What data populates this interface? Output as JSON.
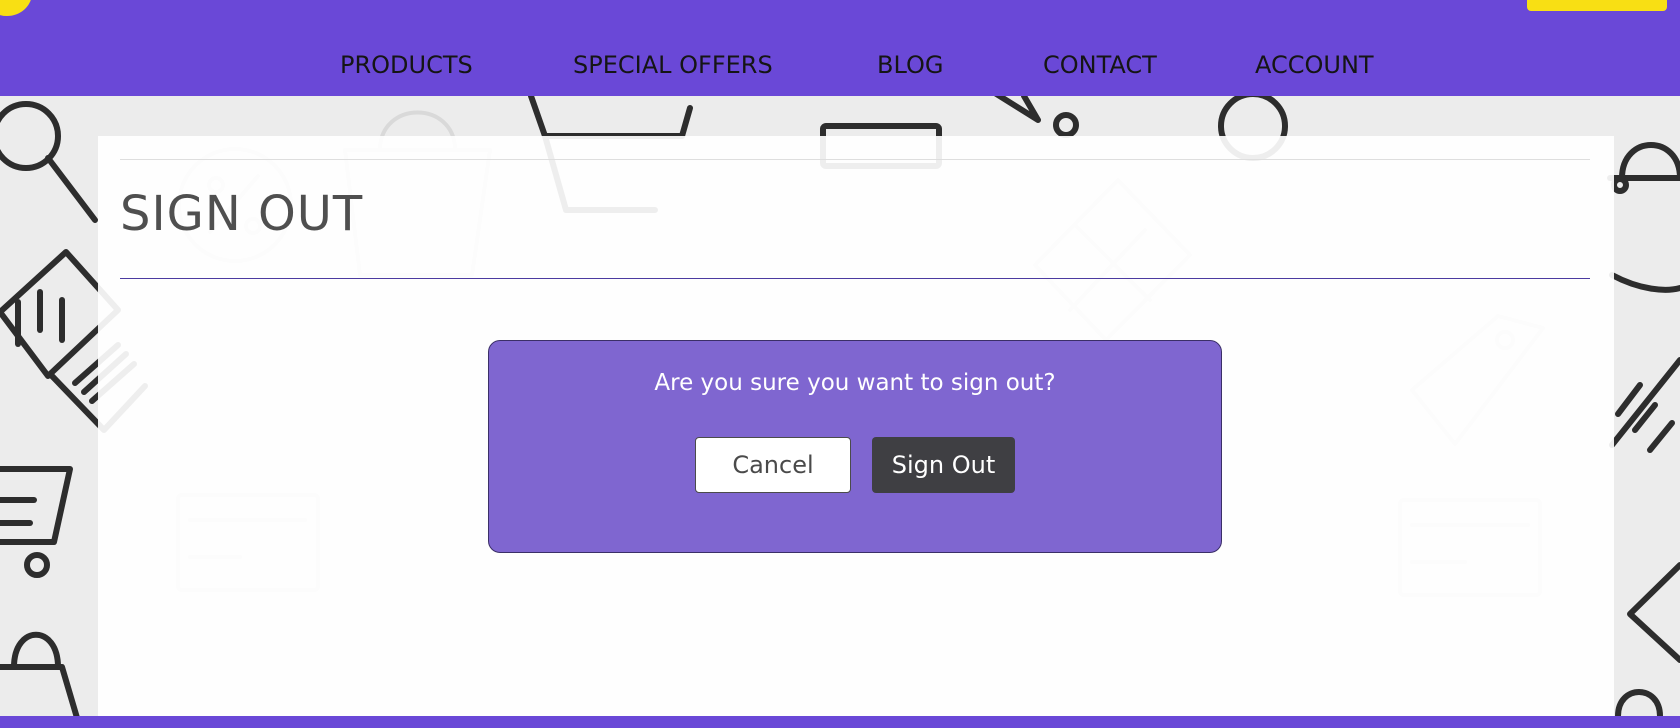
{
  "header": {
    "nav": {
      "products": "PRODUCTS",
      "special_offers": "SPECIAL OFFERS",
      "blog": "BLOG",
      "contact": "CONTACT",
      "account": "ACCOUNT"
    }
  },
  "main": {
    "title": "SIGN OUT",
    "confirm_text": "Are you sure you want to sign out?",
    "cancel_label": "Cancel",
    "signout_label": "Sign Out"
  },
  "colors": {
    "brand_purple": "#6a48d7",
    "accent_yellow": "#f8df14",
    "dialog_purple": "#7f66d0",
    "dark_button": "#3f3f43"
  }
}
